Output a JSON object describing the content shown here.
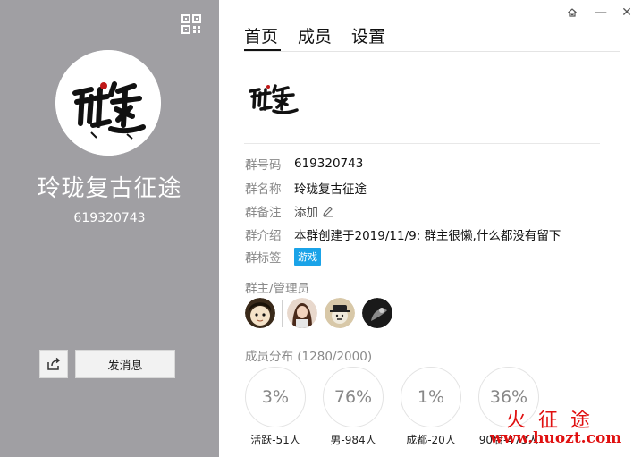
{
  "left_panel": {
    "group_name": "玲珑复古征途",
    "group_number": "619320743",
    "send_message_label": "发消息"
  },
  "window": {
    "minimize_glyph": "—",
    "close_glyph": "✕"
  },
  "tabs": [
    {
      "label": "首页",
      "active": true
    },
    {
      "label": "成员",
      "active": false
    },
    {
      "label": "设置",
      "active": false
    }
  ],
  "info": {
    "group_code": {
      "key": "群号码",
      "value": "619320743"
    },
    "group_name": {
      "key": "群名称",
      "value": "玲珑复古征途"
    },
    "group_remark": {
      "key": "群备注",
      "value": "添加"
    },
    "group_intro": {
      "key": "群介绍",
      "value": "本群创建于2019/11/9:  群主很懒,什么都没有留下"
    },
    "group_tags": {
      "key": "群标签",
      "tag": "游戏"
    }
  },
  "admins_label": "群主/管理员",
  "members_label": "成员分布 (1280/2000)",
  "stats": [
    {
      "percent": "3%",
      "label": "活跃-51人"
    },
    {
      "percent": "76%",
      "label": "男-984人"
    },
    {
      "percent": "1%",
      "label": "成都-20人"
    },
    {
      "percent": "36%",
      "label": "90后-473人"
    }
  ],
  "watermark": {
    "line1": "火征途",
    "line2": "www.huozt.com"
  },
  "colors": {
    "left_panel_bg": "#a09fa3",
    "tag_bg": "#1aa3e8",
    "watermark": "#e01010"
  }
}
